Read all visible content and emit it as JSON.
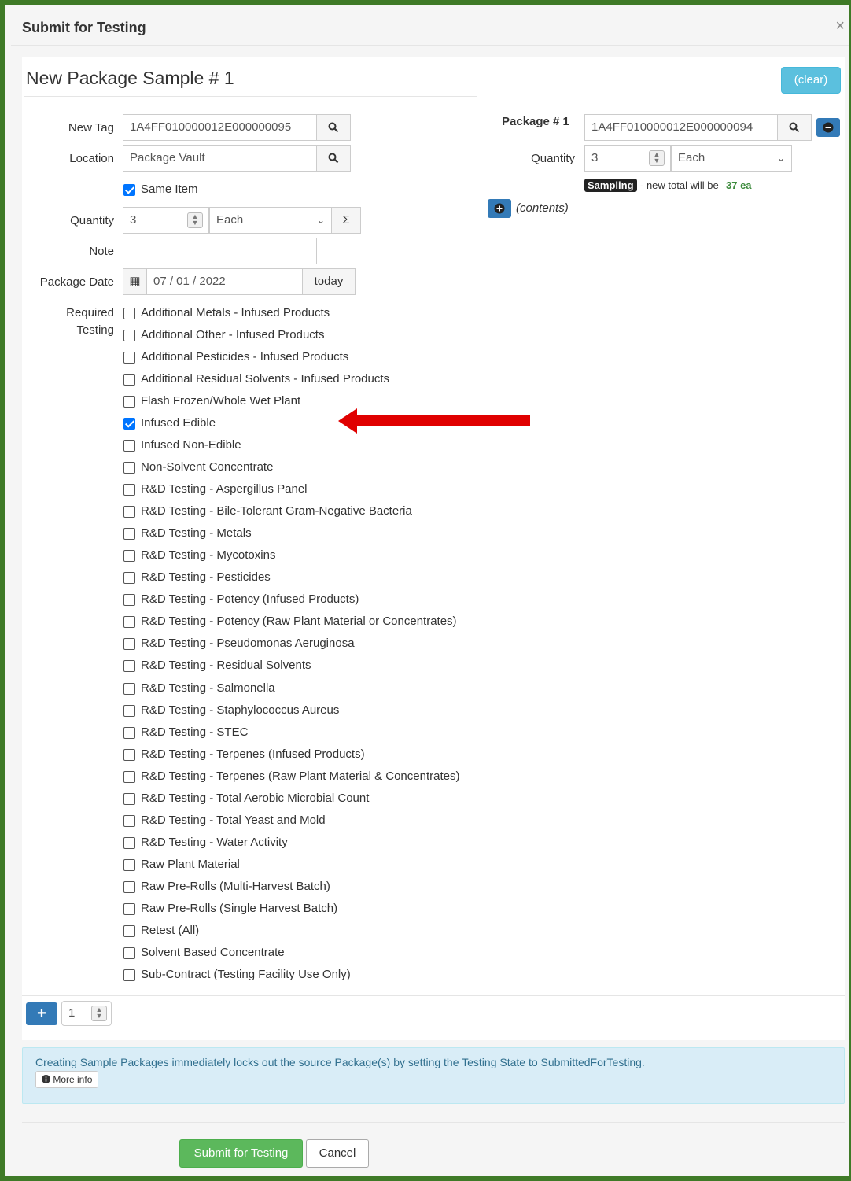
{
  "modal": {
    "title": "Submit for Testing",
    "close": "×"
  },
  "section": {
    "title": "New Package Sample # 1",
    "clear_label": "(clear)"
  },
  "form": {
    "new_tag": {
      "label": "New Tag",
      "value": "1A4FF010000012E000000095"
    },
    "location": {
      "label": "Location",
      "value": "Package Vault"
    },
    "same_item": {
      "label": "Same Item",
      "checked": true
    },
    "quantity": {
      "label": "Quantity",
      "value": "3",
      "unit": "Each",
      "sum_symbol": "Σ"
    },
    "note": {
      "label": "Note",
      "value": ""
    },
    "package_date": {
      "label": "Package Date",
      "value": "07 / 01 / 2022",
      "today_label": "today"
    },
    "required_testing_label_1": "Required",
    "required_testing_label_2": "Testing",
    "testing_options": [
      {
        "label": "Additional Metals - Infused Products",
        "checked": false
      },
      {
        "label": "Additional Other - Infused Products",
        "checked": false
      },
      {
        "label": "Additional Pesticides - Infused Products",
        "checked": false
      },
      {
        "label": "Additional Residual Solvents - Infused Products",
        "checked": false
      },
      {
        "label": "Flash Frozen/Whole Wet Plant",
        "checked": false
      },
      {
        "label": "Infused Edible",
        "checked": true
      },
      {
        "label": "Infused Non-Edible",
        "checked": false
      },
      {
        "label": "Non-Solvent Concentrate",
        "checked": false
      },
      {
        "label": "R&D Testing - Aspergillus Panel",
        "checked": false
      },
      {
        "label": "R&D Testing - Bile-Tolerant Gram-Negative Bacteria",
        "checked": false
      },
      {
        "label": "R&D Testing - Metals",
        "checked": false
      },
      {
        "label": "R&D Testing - Mycotoxins",
        "checked": false
      },
      {
        "label": "R&D Testing - Pesticides",
        "checked": false
      },
      {
        "label": "R&D Testing - Potency (Infused Products)",
        "checked": false
      },
      {
        "label": "R&D Testing - Potency (Raw Plant Material or Concentrates)",
        "checked": false
      },
      {
        "label": "R&D Testing - Pseudomonas Aeruginosa",
        "checked": false
      },
      {
        "label": "R&D Testing - Residual Solvents",
        "checked": false
      },
      {
        "label": "R&D Testing - Salmonella",
        "checked": false
      },
      {
        "label": "R&D Testing - Staphylococcus Aureus",
        "checked": false
      },
      {
        "label": "R&D Testing - STEC",
        "checked": false
      },
      {
        "label": "R&D Testing - Terpenes (Infused Products)",
        "checked": false
      },
      {
        "label": "R&D Testing - Terpenes (Raw Plant Material & Concentrates)",
        "checked": false
      },
      {
        "label": "R&D Testing - Total Aerobic Microbial Count",
        "checked": false
      },
      {
        "label": "R&D Testing - Total Yeast and Mold",
        "checked": false
      },
      {
        "label": "R&D Testing - Water Activity",
        "checked": false
      },
      {
        "label": "Raw Plant Material",
        "checked": false
      },
      {
        "label": "Raw Pre-Rolls (Multi-Harvest Batch)",
        "checked": false
      },
      {
        "label": "Raw Pre-Rolls (Single Harvest Batch)",
        "checked": false
      },
      {
        "label": "Retest (All)",
        "checked": false
      },
      {
        "label": "Solvent Based Concentrate",
        "checked": false
      },
      {
        "label": "Sub-Contract (Testing Facility Use Only)",
        "checked": false
      }
    ]
  },
  "source_package": {
    "label": "Package # 1",
    "tag": "1A4FF010000012E000000094",
    "quantity_label": "Quantity",
    "quantity_value": "3",
    "unit": "Each",
    "badge": "Sampling",
    "total_prefix": "- new total will be",
    "total_value": "37 ea",
    "contents_label": "(contents)"
  },
  "add_row": {
    "count": "1"
  },
  "info": {
    "message": "Creating Sample Packages immediately locks out the source Package(s) by setting the Testing State to SubmittedForTesting.",
    "more_info": "More info"
  },
  "actions": {
    "submit_label": "Submit for Testing",
    "cancel_label": "Cancel"
  },
  "colors": {
    "frame": "#3f7a27",
    "accent": "#5bc0de",
    "primary": "#337ab7",
    "success": "#5cb85c",
    "annotation_arrow": "#e00000"
  }
}
